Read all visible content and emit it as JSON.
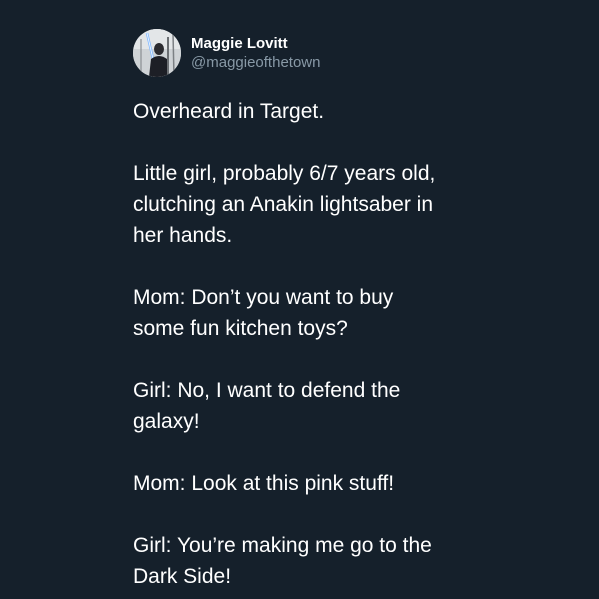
{
  "tweet": {
    "author": {
      "display_name": "Maggie Lovitt",
      "handle": "@maggieofthetown",
      "avatar_icon": "profile-photo-avatar"
    },
    "paragraphs": [
      "Overheard in Target.",
      "Little girl, probably 6/7 years old,\nclutching an Anakin lightsaber in\nher hands.",
      "Mom: Don’t you want to buy\nsome fun kitchen toys?",
      "Girl: No, I want to defend the\ngalaxy!",
      "Mom: Look at this pink stuff!",
      "Girl: You’re making me go to the\nDark Side!"
    ]
  },
  "colors": {
    "background": "#15202b",
    "text": "#ffffff",
    "secondary_text": "#8899a6"
  }
}
